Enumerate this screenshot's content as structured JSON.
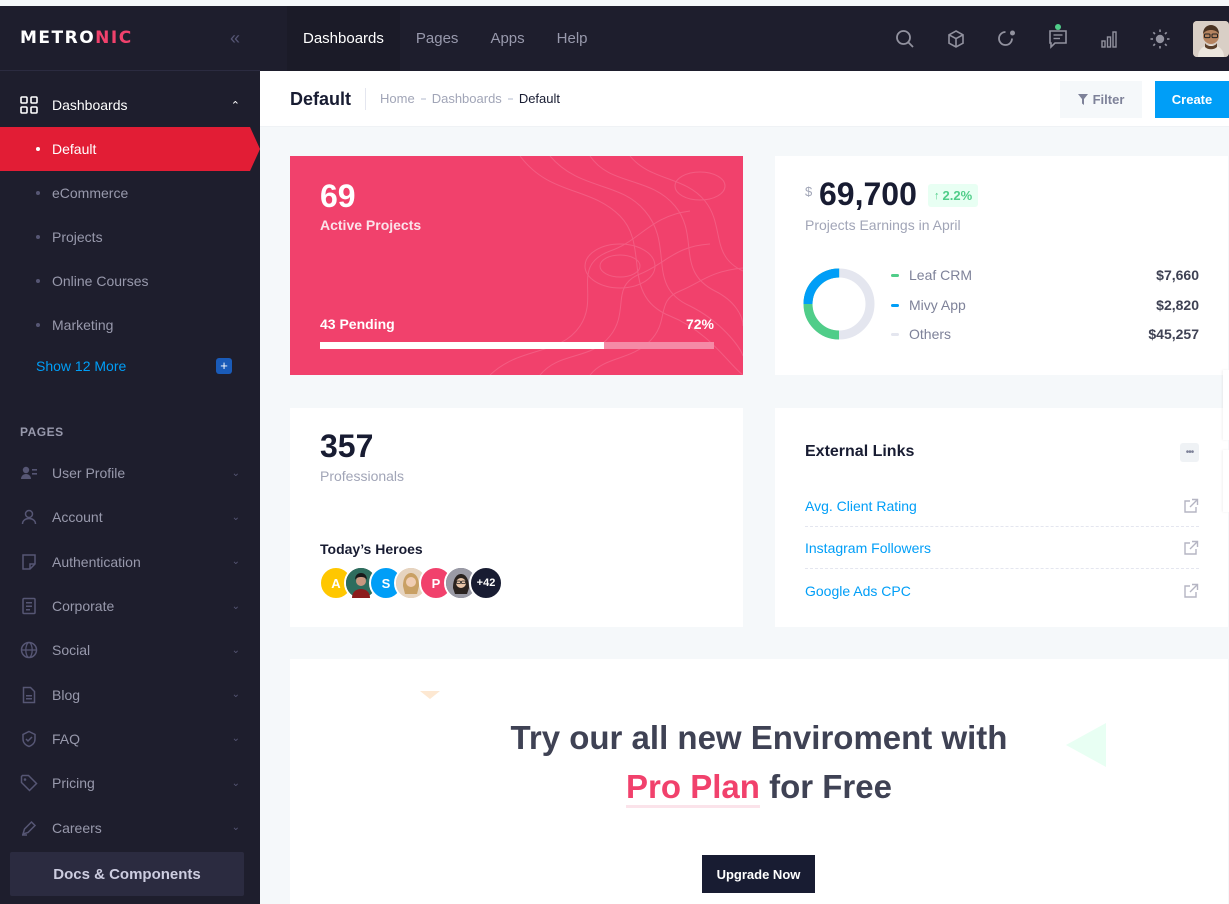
{
  "brand": {
    "name_part1": "METRO",
    "name_part2": "NIC",
    "accent_color": "#f1416c"
  },
  "sidebar": {
    "main_item": {
      "label": "Dashboards",
      "icon": "grid-icon"
    },
    "sub_items": [
      {
        "label": "Default",
        "active": true
      },
      {
        "label": "eCommerce"
      },
      {
        "label": "Projects"
      },
      {
        "label": "Online Courses"
      },
      {
        "label": "Marketing"
      }
    ],
    "show_more": "Show 12 More",
    "section_title": "PAGES",
    "pages": [
      {
        "label": "User Profile",
        "icon": "user-profile-icon"
      },
      {
        "label": "Account",
        "icon": "user-icon"
      },
      {
        "label": "Authentication",
        "icon": "lock-note-icon"
      },
      {
        "label": "Corporate",
        "icon": "document-icon"
      },
      {
        "label": "Social",
        "icon": "globe-icon"
      },
      {
        "label": "Blog",
        "icon": "file-icon"
      },
      {
        "label": "FAQ",
        "icon": "shield-check-icon"
      },
      {
        "label": "Pricing",
        "icon": "tag-icon"
      },
      {
        "label": "Careers",
        "icon": "pen-icon"
      }
    ],
    "docs_button": "Docs & Components"
  },
  "topnav": {
    "tabs": [
      {
        "label": "Dashboards",
        "active": true
      },
      {
        "label": "Pages"
      },
      {
        "label": "Apps"
      },
      {
        "label": "Help"
      }
    ],
    "icons": [
      "search-icon",
      "cube-icon",
      "notification-icon",
      "chat-icon",
      "chart-icon",
      "theme-sun-icon"
    ]
  },
  "toolbar": {
    "title": "Default",
    "breadcrumb": [
      "Home",
      "Dashboards",
      "Default"
    ],
    "filter_label": "Filter",
    "create_label": "Create"
  },
  "projects_card": {
    "count": "69",
    "label": "Active Projects",
    "pending": "43 Pending",
    "percent_label": "72%",
    "progress_fraction": 0.72
  },
  "earnings_card": {
    "currency": "$",
    "amount": "69,700",
    "trend": "2.2%",
    "label": "Projects Earnings in April",
    "legend": [
      {
        "name": "Leaf CRM",
        "value": "$7,660",
        "color": "#50cd89"
      },
      {
        "name": "Mivy App",
        "value": "$2,820",
        "color": "#009ef7"
      },
      {
        "name": "Others",
        "value": "$45,257",
        "color": "#e4e6ef"
      }
    ]
  },
  "pros_card": {
    "count": "357",
    "label": "Professionals",
    "heroes_title": "Today’s Heroes",
    "heroes": [
      {
        "initial": "A",
        "color": "#ffc700"
      },
      {
        "initial": "",
        "color": "#1f5b4f"
      },
      {
        "initial": "S",
        "color": "#009ef7"
      },
      {
        "initial": "",
        "color": "#d8b796"
      },
      {
        "initial": "P",
        "color": "#f1416c"
      },
      {
        "initial": "",
        "color": "#5e6278"
      },
      {
        "initial": "+42",
        "color": "#181c32"
      }
    ]
  },
  "links_card": {
    "title": "External Links",
    "links": [
      "Avg. Client Rating",
      "Instagram Followers",
      "Google Ads CPC"
    ]
  },
  "promo_card": {
    "line1": "Try our all new Enviroment with",
    "highlight": "Pro Plan",
    "line2_rest": " for Free",
    "button": "Upgrade Now"
  }
}
